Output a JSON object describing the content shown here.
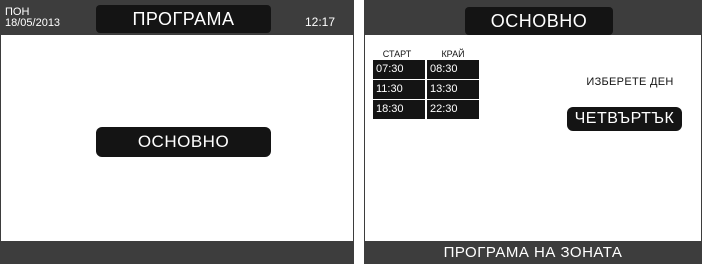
{
  "left_screen": {
    "header": {
      "day": "ПОН",
      "date": "18/05/2013",
      "title": "ПРОГРАМА",
      "time": "12:17"
    },
    "program_button": "ОСНОВНО"
  },
  "right_screen": {
    "header": {
      "title": "ОСНОВНО"
    },
    "schedule": {
      "columns": [
        "СТАРТ",
        "КРАЙ"
      ],
      "rows": [
        {
          "start": "07:30",
          "end": "08:30"
        },
        {
          "start": "11:30",
          "end": "13:30"
        },
        {
          "start": "18:30",
          "end": "22:30"
        }
      ]
    },
    "select_day_label": "ИЗБЕРЕТЕ ДЕН",
    "day_button": "ЧЕТВЪРТЪК",
    "footer": {
      "label": "ПРОГРАМА НА ЗОНАТА"
    }
  },
  "colors": {
    "bar": "#3d3d3d",
    "pill": "#141414",
    "text_light": "#ffffff",
    "background": "#ffffff"
  }
}
